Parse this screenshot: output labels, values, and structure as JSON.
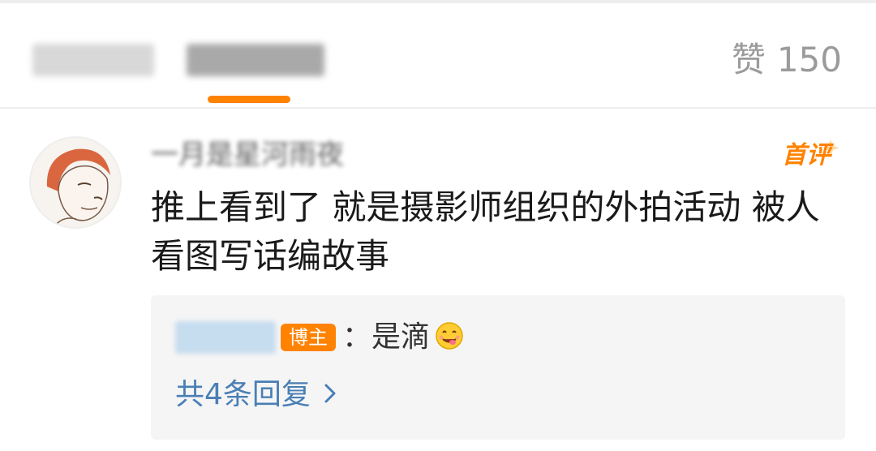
{
  "tabs": [
    {
      "label": "转发"
    },
    {
      "label": "评论"
    }
  ],
  "likes": {
    "label": "赞",
    "count": "150"
  },
  "comment": {
    "username": "一月是星河雨夜",
    "badge": "首评",
    "text": "推上看到了 就是摄影师组织的外拍活动 被人看图写话编故事"
  },
  "reply": {
    "op_badge": "博主",
    "text": "：是滴",
    "emoji": "yummy-face-icon",
    "more_label": "共4条回复",
    "more_chevron": "›"
  },
  "colors": {
    "accent": "#ff8200",
    "link": "#4a7fb5",
    "muted": "#9b9b9b"
  }
}
